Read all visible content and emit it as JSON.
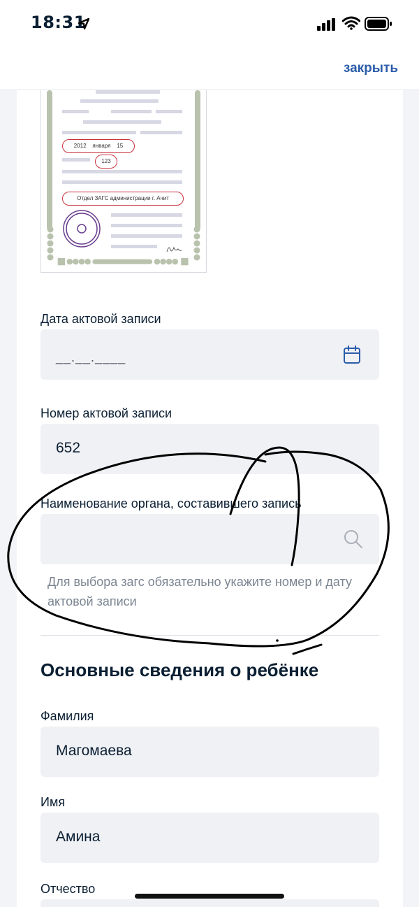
{
  "status_bar": {
    "time": "18:31"
  },
  "nav": {
    "close_label": "закрыть"
  },
  "certificate": {
    "date_day": "2012",
    "date_month": "января",
    "date_year": "15",
    "record_number": "123",
    "office": "Отдел ЗАГС администрации г. Ачит"
  },
  "form": {
    "record_date": {
      "label": "Дата актовой записи",
      "placeholder": "__.__.____"
    },
    "record_number": {
      "label": "Номер актовой записи",
      "value": "652"
    },
    "authority": {
      "label": "Наименование органа, составившего запись",
      "value": "",
      "hint": "Для выбора загс обязательно укажите номер и дату актовой записи"
    }
  },
  "child_section": {
    "title": "Основные сведения о ребёнке",
    "surname": {
      "label": "Фамилия",
      "value": "Магомаева"
    },
    "name": {
      "label": "Имя",
      "value": "Амина"
    },
    "patronymic": {
      "label": "Отчество",
      "value": ""
    }
  },
  "colors": {
    "accent": "#2b5da9",
    "field_bg": "#f0f1f5",
    "annotation": "#000000"
  }
}
